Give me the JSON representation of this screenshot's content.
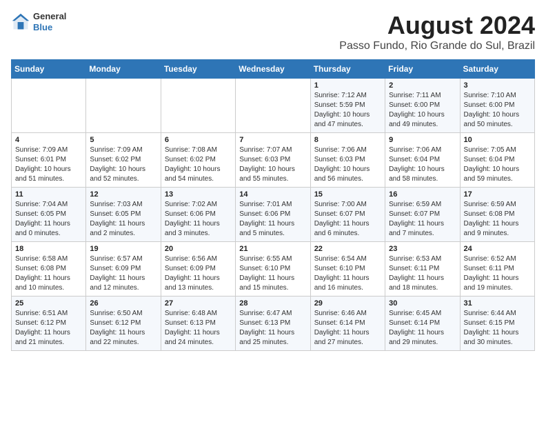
{
  "header": {
    "logo_line1": "General",
    "logo_line2": "Blue",
    "title": "August 2024",
    "subtitle": "Passo Fundo, Rio Grande do Sul, Brazil"
  },
  "days_of_week": [
    "Sunday",
    "Monday",
    "Tuesday",
    "Wednesday",
    "Thursday",
    "Friday",
    "Saturday"
  ],
  "weeks": [
    [
      {
        "day": "",
        "info": ""
      },
      {
        "day": "",
        "info": ""
      },
      {
        "day": "",
        "info": ""
      },
      {
        "day": "",
        "info": ""
      },
      {
        "day": "1",
        "info": "Sunrise: 7:12 AM\nSunset: 5:59 PM\nDaylight: 10 hours\nand 47 minutes."
      },
      {
        "day": "2",
        "info": "Sunrise: 7:11 AM\nSunset: 6:00 PM\nDaylight: 10 hours\nand 49 minutes."
      },
      {
        "day": "3",
        "info": "Sunrise: 7:10 AM\nSunset: 6:00 PM\nDaylight: 10 hours\nand 50 minutes."
      }
    ],
    [
      {
        "day": "4",
        "info": "Sunrise: 7:09 AM\nSunset: 6:01 PM\nDaylight: 10 hours\nand 51 minutes."
      },
      {
        "day": "5",
        "info": "Sunrise: 7:09 AM\nSunset: 6:02 PM\nDaylight: 10 hours\nand 52 minutes."
      },
      {
        "day": "6",
        "info": "Sunrise: 7:08 AM\nSunset: 6:02 PM\nDaylight: 10 hours\nand 54 minutes."
      },
      {
        "day": "7",
        "info": "Sunrise: 7:07 AM\nSunset: 6:03 PM\nDaylight: 10 hours\nand 55 minutes."
      },
      {
        "day": "8",
        "info": "Sunrise: 7:06 AM\nSunset: 6:03 PM\nDaylight: 10 hours\nand 56 minutes."
      },
      {
        "day": "9",
        "info": "Sunrise: 7:06 AM\nSunset: 6:04 PM\nDaylight: 10 hours\nand 58 minutes."
      },
      {
        "day": "10",
        "info": "Sunrise: 7:05 AM\nSunset: 6:04 PM\nDaylight: 10 hours\nand 59 minutes."
      }
    ],
    [
      {
        "day": "11",
        "info": "Sunrise: 7:04 AM\nSunset: 6:05 PM\nDaylight: 11 hours\nand 0 minutes."
      },
      {
        "day": "12",
        "info": "Sunrise: 7:03 AM\nSunset: 6:05 PM\nDaylight: 11 hours\nand 2 minutes."
      },
      {
        "day": "13",
        "info": "Sunrise: 7:02 AM\nSunset: 6:06 PM\nDaylight: 11 hours\nand 3 minutes."
      },
      {
        "day": "14",
        "info": "Sunrise: 7:01 AM\nSunset: 6:06 PM\nDaylight: 11 hours\nand 5 minutes."
      },
      {
        "day": "15",
        "info": "Sunrise: 7:00 AM\nSunset: 6:07 PM\nDaylight: 11 hours\nand 6 minutes."
      },
      {
        "day": "16",
        "info": "Sunrise: 6:59 AM\nSunset: 6:07 PM\nDaylight: 11 hours\nand 7 minutes."
      },
      {
        "day": "17",
        "info": "Sunrise: 6:59 AM\nSunset: 6:08 PM\nDaylight: 11 hours\nand 9 minutes."
      }
    ],
    [
      {
        "day": "18",
        "info": "Sunrise: 6:58 AM\nSunset: 6:08 PM\nDaylight: 11 hours\nand 10 minutes."
      },
      {
        "day": "19",
        "info": "Sunrise: 6:57 AM\nSunset: 6:09 PM\nDaylight: 11 hours\nand 12 minutes."
      },
      {
        "day": "20",
        "info": "Sunrise: 6:56 AM\nSunset: 6:09 PM\nDaylight: 11 hours\nand 13 minutes."
      },
      {
        "day": "21",
        "info": "Sunrise: 6:55 AM\nSunset: 6:10 PM\nDaylight: 11 hours\nand 15 minutes."
      },
      {
        "day": "22",
        "info": "Sunrise: 6:54 AM\nSunset: 6:10 PM\nDaylight: 11 hours\nand 16 minutes."
      },
      {
        "day": "23",
        "info": "Sunrise: 6:53 AM\nSunset: 6:11 PM\nDaylight: 11 hours\nand 18 minutes."
      },
      {
        "day": "24",
        "info": "Sunrise: 6:52 AM\nSunset: 6:11 PM\nDaylight: 11 hours\nand 19 minutes."
      }
    ],
    [
      {
        "day": "25",
        "info": "Sunrise: 6:51 AM\nSunset: 6:12 PM\nDaylight: 11 hours\nand 21 minutes."
      },
      {
        "day": "26",
        "info": "Sunrise: 6:50 AM\nSunset: 6:12 PM\nDaylight: 11 hours\nand 22 minutes."
      },
      {
        "day": "27",
        "info": "Sunrise: 6:48 AM\nSunset: 6:13 PM\nDaylight: 11 hours\nand 24 minutes."
      },
      {
        "day": "28",
        "info": "Sunrise: 6:47 AM\nSunset: 6:13 PM\nDaylight: 11 hours\nand 25 minutes."
      },
      {
        "day": "29",
        "info": "Sunrise: 6:46 AM\nSunset: 6:14 PM\nDaylight: 11 hours\nand 27 minutes."
      },
      {
        "day": "30",
        "info": "Sunrise: 6:45 AM\nSunset: 6:14 PM\nDaylight: 11 hours\nand 29 minutes."
      },
      {
        "day": "31",
        "info": "Sunrise: 6:44 AM\nSunset: 6:15 PM\nDaylight: 11 hours\nand 30 minutes."
      }
    ]
  ]
}
